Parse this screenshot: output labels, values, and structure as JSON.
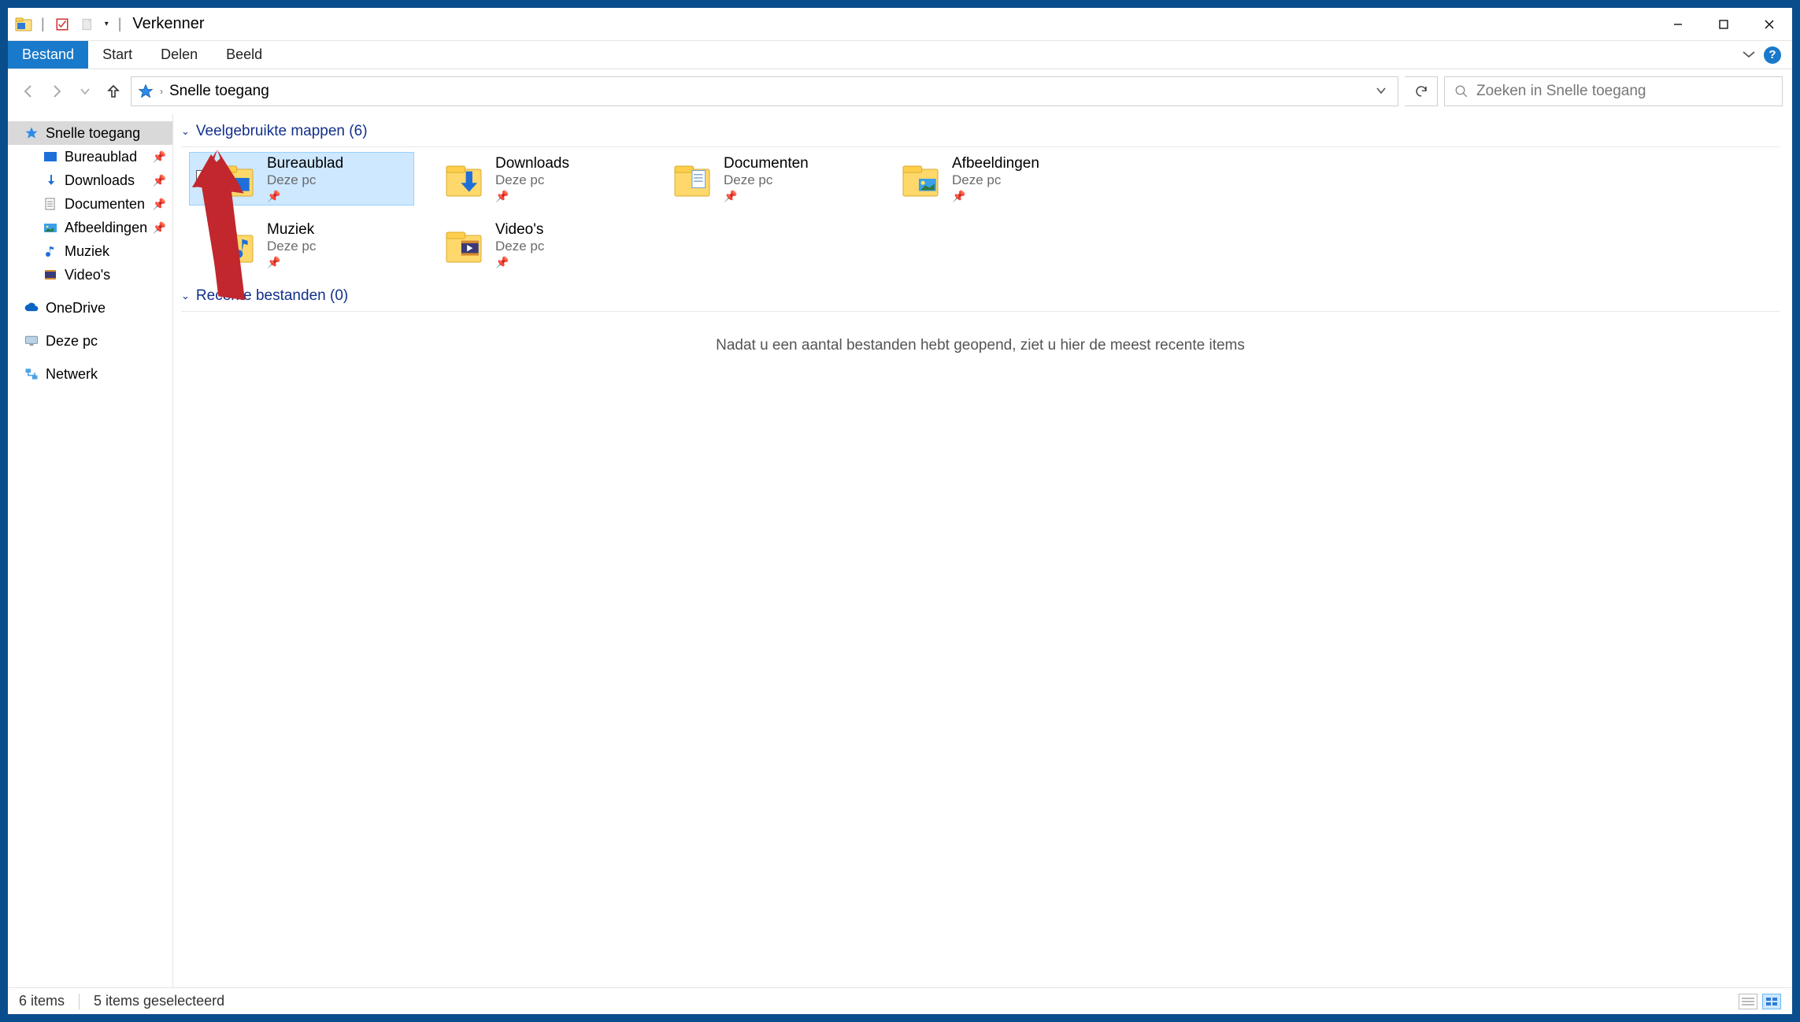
{
  "titlebar": {
    "title": "Verkenner"
  },
  "ribbon": {
    "file": "Bestand",
    "tabs": [
      "Start",
      "Delen",
      "Beeld"
    ]
  },
  "address": {
    "location": "Snelle toegang",
    "search_placeholder": "Zoeken in Snelle toegang"
  },
  "sidebar": {
    "quick_access": "Snelle toegang",
    "items": [
      {
        "label": "Bureaublad",
        "icon": "desktop",
        "pinned": true
      },
      {
        "label": "Downloads",
        "icon": "downloads",
        "pinned": true
      },
      {
        "label": "Documenten",
        "icon": "documents",
        "pinned": true
      },
      {
        "label": "Afbeeldingen",
        "icon": "pictures",
        "pinned": true
      },
      {
        "label": "Muziek",
        "icon": "music",
        "pinned": false
      },
      {
        "label": "Video's",
        "icon": "videos",
        "pinned": false
      }
    ],
    "onedrive": "OneDrive",
    "this_pc": "Deze pc",
    "network": "Netwerk"
  },
  "content": {
    "group1": {
      "label": "Veelgebruikte mappen",
      "count": 6
    },
    "folders": [
      {
        "name": "Bureaublad",
        "sub": "Deze pc",
        "icon": "desktop",
        "selected": true
      },
      {
        "name": "Downloads",
        "sub": "Deze pc",
        "icon": "downloads",
        "selected": false
      },
      {
        "name": "Documenten",
        "sub": "Deze pc",
        "icon": "documents",
        "selected": false
      },
      {
        "name": "Afbeeldingen",
        "sub": "Deze pc",
        "icon": "pictures",
        "selected": false
      },
      {
        "name": "Muziek",
        "sub": "Deze pc",
        "icon": "music",
        "selected": false
      },
      {
        "name": "Video's",
        "sub": "Deze pc",
        "icon": "videos",
        "selected": false
      }
    ],
    "group2": {
      "label": "Recente bestanden",
      "count": 0
    },
    "empty_message": "Nadat u een aantal bestanden hebt geopend, ziet u hier de meest recente items"
  },
  "statusbar": {
    "items": "6 items",
    "selected": "5 items geselecteerd"
  }
}
